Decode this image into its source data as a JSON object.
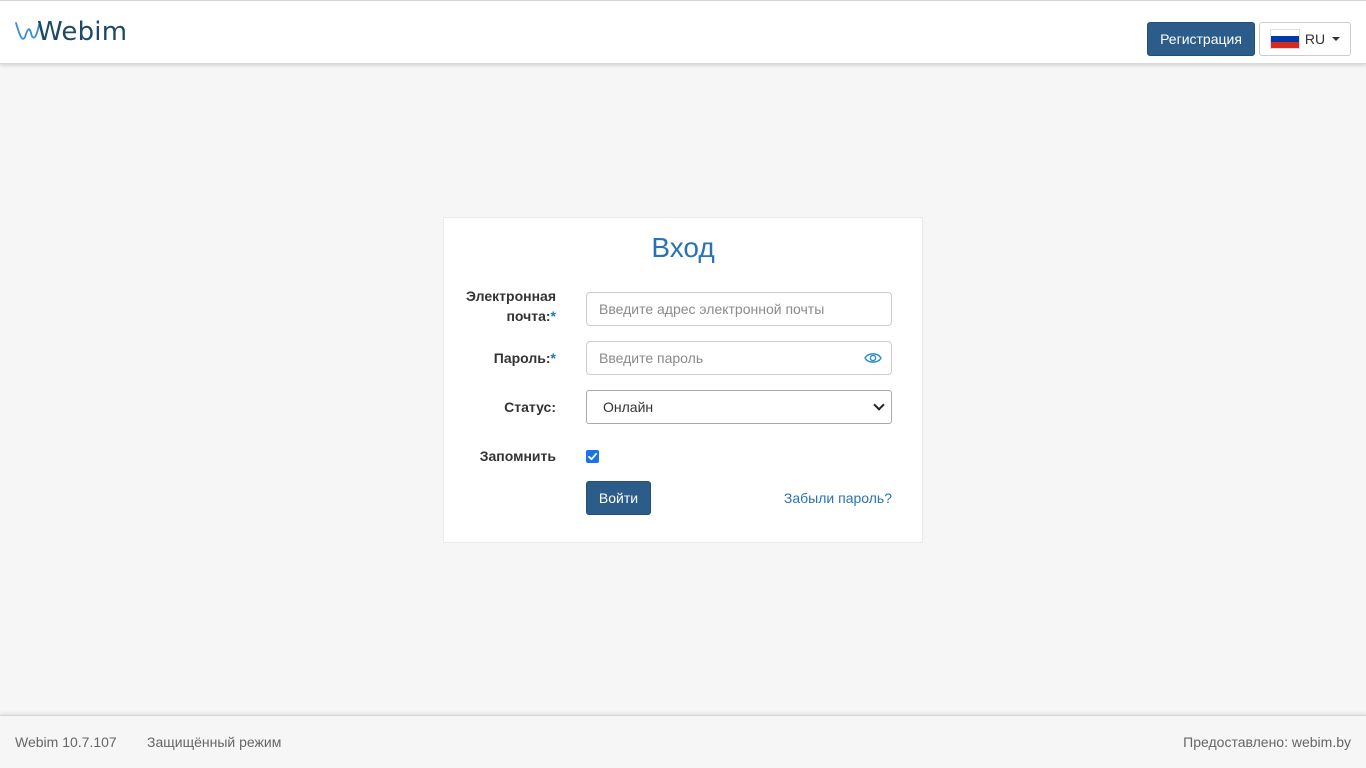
{
  "header": {
    "logo_text": "Webim",
    "register_label": "Регистрация",
    "language": {
      "code": "RU",
      "flag_icon": "russia-flag-icon",
      "flag_colors": [
        "#ffffff",
        "#0039a6",
        "#d52b1e"
      ]
    }
  },
  "login": {
    "title": "Вход",
    "email": {
      "label_line1": "Электронная",
      "label_line2": "почта:",
      "required_mark": "*",
      "placeholder": "Введите адрес электронной почты",
      "value": ""
    },
    "password": {
      "label": "Пароль:",
      "required_mark": "*",
      "placeholder": "Введите пароль",
      "value": "",
      "toggle_icon": "eye-icon"
    },
    "status": {
      "label": "Статус:",
      "selected": "Онлайн"
    },
    "remember": {
      "label": "Запомнить",
      "checked": true
    },
    "submit_label": "Войти",
    "forgot_label": "Забыли пароль?"
  },
  "footer": {
    "version": "Webim 10.7.107",
    "secure_mode": "Защищённый режим",
    "provided_by": "Предоставлено: webim.by"
  },
  "colors": {
    "primary": "#2b5c8a",
    "link": "#2a73b3",
    "background": "#f6f6f6"
  }
}
